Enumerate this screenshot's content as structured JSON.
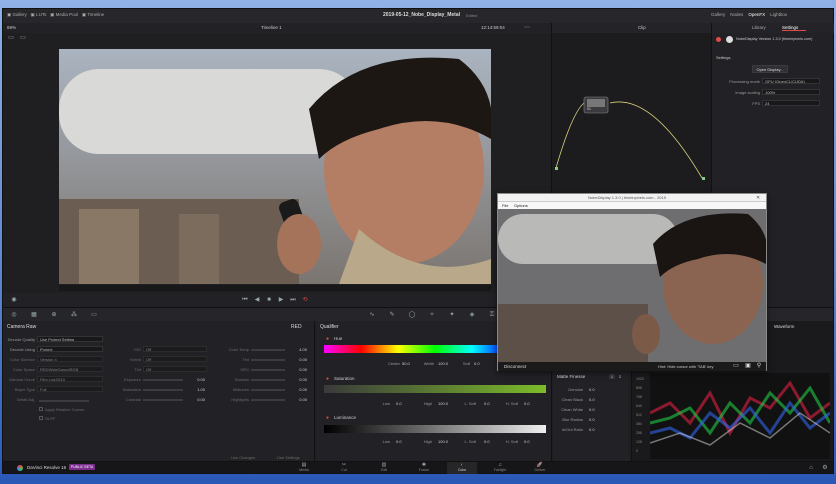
{
  "topbar": {
    "left_tabs": [
      {
        "label": "Gallery",
        "icon": "gallery-icon"
      },
      {
        "label": "LUTs",
        "icon": "luts-icon"
      },
      {
        "label": "Media Pool",
        "icon": "media-pool-icon"
      },
      {
        "label": "Timeline",
        "icon": "timeline-icon"
      }
    ],
    "title": "2019-05-12_Nobe_Display_Metal",
    "edited": "Edited",
    "right_tabs": [
      {
        "label": "Gallery",
        "icon": "gallery-icon"
      },
      {
        "label": "Nodes",
        "icon": "nodes-icon"
      },
      {
        "label": "OpenFX",
        "icon": "openfx-icon"
      },
      {
        "label": "Lightbox",
        "icon": "lightbox-icon"
      }
    ]
  },
  "viewer_bar": {
    "zoom": "69%",
    "timeline": "Timeline 1",
    "timecode": "12:14:59:04",
    "mode": "Clip"
  },
  "openfx": {
    "tab_library": "Library",
    "tab_settings": "Settings",
    "plugin_name": "NobeDisplay Version 1.3.0 (timeinpixels.com)",
    "section": "Settings",
    "open_button": "Open Display...",
    "rows": [
      {
        "label": "Processing mode",
        "value": "GPU (OpenCL/CUDA)"
      },
      {
        "label": "Image scaling",
        "value": "100%"
      },
      {
        "label": "FPS",
        "value": "24"
      }
    ]
  },
  "nodes": {
    "node_label": "01"
  },
  "popup": {
    "title": "NobeDisplay 1.3.0 | timeinpixels.com - 2019",
    "menu": [
      "File",
      "Options"
    ],
    "footer_left": "Disconnect",
    "footer_hint": "Hint: Hide cursor with 'TAB' key"
  },
  "transport": {
    "icons": [
      "skip-back-icon",
      "prev-frame-icon",
      "stop-icon",
      "play-icon",
      "next-frame-icon",
      "loop-icon"
    ]
  },
  "camera_raw": {
    "title": "Camera Raw",
    "format": "RED",
    "left_rows": [
      {
        "label": "Decode Quality",
        "value": "Use Project Setting"
      },
      {
        "label": "Decode Using",
        "value": "Project"
      },
      {
        "label": "Color Science",
        "value": "Version 4"
      },
      {
        "label": "Color Space",
        "value": "REDWideGamutRGB"
      },
      {
        "label": "Gamma Curve",
        "value": "Film Log3G10"
      },
      {
        "label": "Bayer Type",
        "value": "Full"
      },
      {
        "label": "Detail Adj.",
        "value": ""
      }
    ],
    "checks": [
      "Apply Relative Curves",
      "OLPF"
    ],
    "mid_rows": [
      {
        "label": "ISO",
        "value": "Off"
      },
      {
        "label": "Kelvin",
        "value": "Off"
      },
      {
        "label": "Tint",
        "value": "Off"
      },
      {
        "label": "Exposure",
        "value": "0.00"
      },
      {
        "label": "Saturation",
        "value": "1.00"
      },
      {
        "label": "Contrast",
        "value": "0.00"
      }
    ],
    "right_rows": [
      {
        "label": "Color Temp",
        "value": "4.00"
      },
      {
        "label": "Tint",
        "value": "0.00"
      },
      {
        "label": "DRX",
        "value": "0.00"
      },
      {
        "label": "Shadow",
        "value": "0.00"
      },
      {
        "label": "Midtones",
        "value": "0.00"
      },
      {
        "label": "Highlights",
        "value": "0.00"
      }
    ],
    "footer": [
      "Use Changes",
      "Use Settings"
    ]
  },
  "qualifier": {
    "title": "Qualifier",
    "hue": {
      "label": "Hue",
      "center": "50.0",
      "width": "100.0",
      "soft": "0.0",
      "l_center": "Center",
      "l_width": "Width",
      "l_soft": "Soft"
    },
    "sat": {
      "label": "Saturation",
      "low": "0.0",
      "high": "100.0",
      "lsoft": "0.0",
      "hsoft": "0.0"
    },
    "lum": {
      "label": "Luminance",
      "low": "0.0",
      "high": "100.0",
      "lsoft": "0.0",
      "hsoft": "0.0"
    },
    "l_low": "Low",
    "l_high": "High",
    "l_lsoft": "L. Soft",
    "l_hsoft": "H. Soft"
  },
  "matte": {
    "title": "Matte Finesse",
    "pages": [
      "1",
      "2"
    ],
    "rows": [
      {
        "label": "Denoise",
        "value": "0.0"
      },
      {
        "label": "Clean Black",
        "value": "0.0"
      },
      {
        "label": "Clean White",
        "value": "0.0"
      },
      {
        "label": "Blur Radius",
        "value": "0.0"
      },
      {
        "label": "In/Out Ratio",
        "value": "0.0"
      }
    ]
  },
  "scope": {
    "title": "Waveform",
    "ticks": [
      "1023",
      "896",
      "768",
      "640",
      "512",
      "384",
      "256",
      "128",
      "0"
    ]
  },
  "pages": [
    {
      "label": "Media",
      "icon": "media-icon"
    },
    {
      "label": "Cut",
      "icon": "cut-icon"
    },
    {
      "label": "Edit",
      "icon": "edit-icon"
    },
    {
      "label": "Fusion",
      "icon": "fusion-icon"
    },
    {
      "label": "Color",
      "icon": "color-icon"
    },
    {
      "label": "Fairlight",
      "icon": "fairlight-icon"
    },
    {
      "label": "Deliver",
      "icon": "deliver-icon"
    }
  ],
  "brand": {
    "name": "DaVinci Resolve 16",
    "badge": "PUBLIC BETA"
  },
  "colors": {
    "accent": "#e04a4a",
    "bg": "#1f1f22"
  }
}
